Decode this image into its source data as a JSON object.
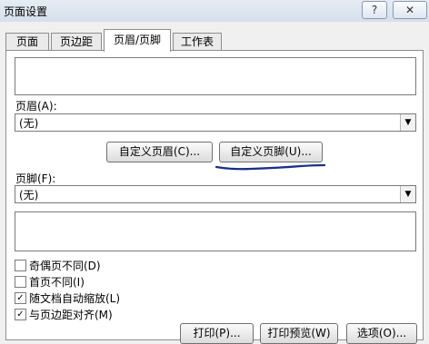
{
  "window": {
    "title": "页面设置",
    "help_label": "?",
    "close_label": "✕"
  },
  "tabs": [
    {
      "label": "页面"
    },
    {
      "label": "页边距"
    },
    {
      "label": "页眉/页脚",
      "active": true
    },
    {
      "label": "工作表"
    }
  ],
  "header": {
    "label": "页眉(A):",
    "selected": "(无)",
    "custom_header_button": "自定义页眉(C)...",
    "custom_footer_button": "自定义页脚(U)..."
  },
  "footer": {
    "label": "页脚(F):",
    "selected": "(无)"
  },
  "options": [
    {
      "label": "奇偶页不同(D)",
      "checked": false
    },
    {
      "label": "首页不同(I)",
      "checked": false
    },
    {
      "label": "随文档自动缩放(L)",
      "checked": true
    },
    {
      "label": "与页边距对齐(M)",
      "checked": true
    }
  ],
  "buttons": {
    "print": "打印(P)...",
    "print_preview": "打印预览(W)",
    "options": "选项(O)..."
  },
  "colors": {
    "annotation_ink": "#1a2f8a"
  }
}
